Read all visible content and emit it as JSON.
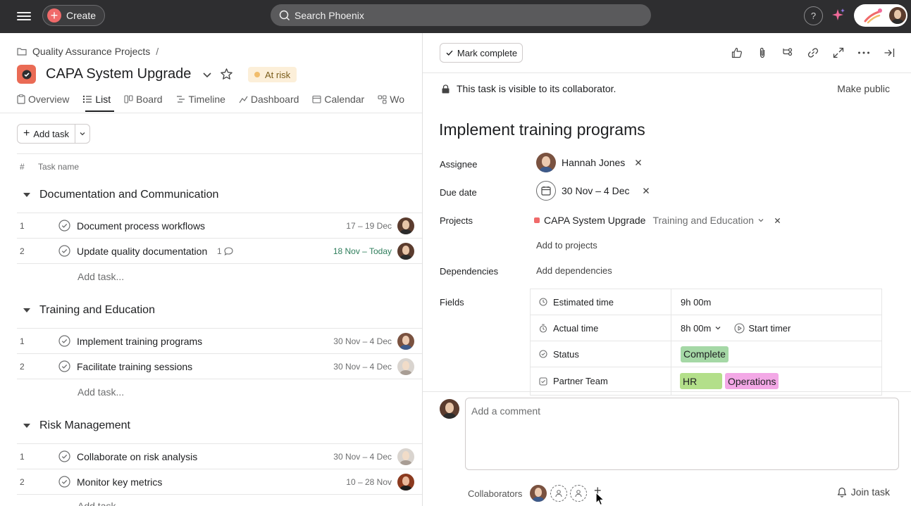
{
  "topbar": {
    "create_label": "Create",
    "search_placeholder": "Search Phoenix",
    "help_label": "?"
  },
  "project": {
    "breadcrumb": "Quality Assurance Projects",
    "breadcrumb_sep": "/",
    "title": "CAPA System Upgrade",
    "status": "At risk",
    "status_color": "#f1bd6c",
    "icon_color": "#ea6b55"
  },
  "tabs": [
    {
      "label": "Overview",
      "icon": "clipboard-icon"
    },
    {
      "label": "List",
      "icon": "list-icon",
      "active": true
    },
    {
      "label": "Board",
      "icon": "board-icon"
    },
    {
      "label": "Timeline",
      "icon": "timeline-icon"
    },
    {
      "label": "Dashboard",
      "icon": "dashboard-icon"
    },
    {
      "label": "Calendar",
      "icon": "calendar-icon"
    },
    {
      "label": "Wo",
      "icon": "workflow-icon"
    }
  ],
  "list": {
    "add_task_label": "Add task",
    "col_hash": "#",
    "col_name": "Task name",
    "add_task_placeholder": "Add task...",
    "sections": [
      {
        "title": "Documentation and Communication",
        "tasks": [
          {
            "num": "1",
            "name": "Document process workflows",
            "due": "17 – 19 Dec",
            "due_color": "default",
            "comments": "",
            "avatar": "dark"
          },
          {
            "num": "2",
            "name": "Update quality documentation",
            "due": "18 Nov – Today",
            "due_color": "green",
            "comments": "1",
            "avatar": "dark"
          }
        ]
      },
      {
        "title": "Training and Education",
        "tasks": [
          {
            "num": "1",
            "name": "Implement training programs",
            "due": "30 Nov – 4 Dec",
            "due_color": "default",
            "comments": "",
            "avatar": "blue"
          },
          {
            "num": "2",
            "name": "Facilitate training sessions",
            "due": "30 Nov – 4 Dec",
            "due_color": "default",
            "comments": "",
            "avatar": "light"
          }
        ]
      },
      {
        "title": "Risk Management",
        "tasks": [
          {
            "num": "1",
            "name": "Collaborate on risk analysis",
            "due": "30 Nov – 4 Dec",
            "due_color": "default",
            "comments": "",
            "avatar": "light"
          },
          {
            "num": "2",
            "name": "Monitor key metrics",
            "due": "10 – 28 Nov",
            "due_color": "default",
            "comments": "",
            "avatar": "red"
          }
        ]
      }
    ]
  },
  "detail": {
    "mark_complete": "Mark complete",
    "visibility_text": "This task is visible to its collaborator.",
    "make_public": "Make public",
    "title": "Implement training programs",
    "labels": {
      "assignee": "Assignee",
      "due_date": "Due date",
      "projects": "Projects",
      "dependencies": "Dependencies",
      "fields": "Fields"
    },
    "assignee_name": "Hannah Jones",
    "due_date": "30 Nov – 4 Dec",
    "project_name": "CAPA System Upgrade",
    "project_section": "Training and Education",
    "add_to_projects": "Add to projects",
    "add_dependencies": "Add dependencies",
    "fields": {
      "estimated_label": "Estimated time",
      "estimated_value": "9h 00m",
      "actual_label": "Actual time",
      "actual_value": "8h 00m",
      "start_timer": "Start timer",
      "status_label": "Status",
      "status_value": "Complete",
      "status_color": "#a5d8a6",
      "partner_label": "Partner Team",
      "partner_values": [
        {
          "label": "HR",
          "color": "#b3df8a"
        },
        {
          "label": "Operations",
          "color": "#f3a8e6"
        }
      ]
    },
    "comment_placeholder": "Add a comment",
    "collaborators_label": "Collaborators",
    "collab_plus": "+",
    "join_task": "Join task"
  }
}
